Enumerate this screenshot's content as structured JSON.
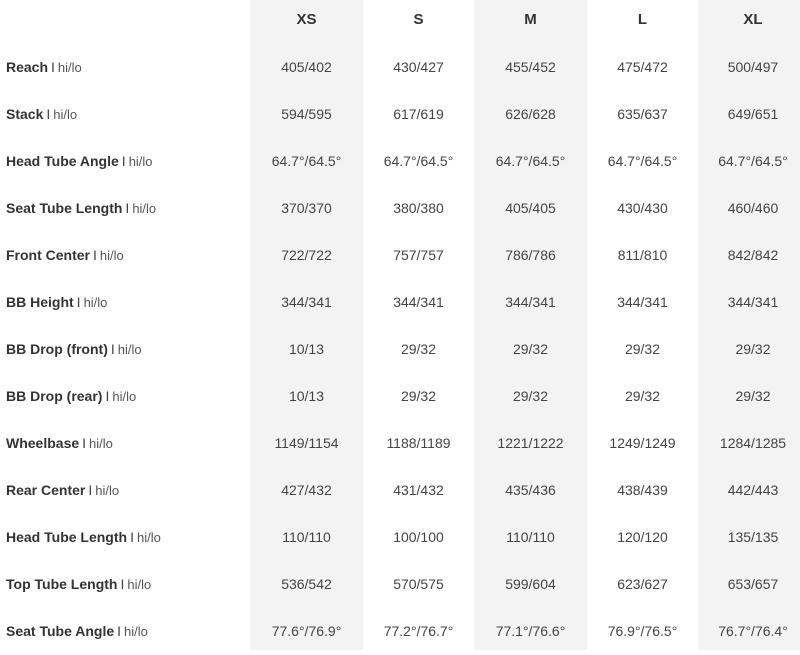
{
  "sizes": [
    "XS",
    "S",
    "M",
    "L",
    "XL"
  ],
  "rows": [
    {
      "label": "Reach",
      "sep": "I",
      "sub": "hi/lo",
      "values": [
        "405/402",
        "430/427",
        "455/452",
        "475/472",
        "500/497"
      ]
    },
    {
      "label": "Stack",
      "sep": "I",
      "sub": "hi/lo",
      "values": [
        "594/595",
        "617/619",
        "626/628",
        "635/637",
        "649/651"
      ]
    },
    {
      "label": "Head Tube Angle",
      "sep": "I",
      "sub": "hi/lo",
      "values": [
        "64.7°/64.5°",
        "64.7°/64.5°",
        "64.7°/64.5°",
        "64.7°/64.5°",
        "64.7°/64.5°"
      ]
    },
    {
      "label": "Seat Tube Length",
      "sep": "I",
      "sub": "hi/lo",
      "values": [
        "370/370",
        "380/380",
        "405/405",
        "430/430",
        "460/460"
      ]
    },
    {
      "label": "Front Center",
      "sep": "I",
      "sub": "hi/lo",
      "values": [
        "722/722",
        "757/757",
        "786/786",
        "811/810",
        "842/842"
      ]
    },
    {
      "label": "BB Height",
      "sep": "I",
      "sub": "hi/lo",
      "values": [
        "344/341",
        "344/341",
        "344/341",
        "344/341",
        "344/341"
      ]
    },
    {
      "label": "BB Drop (front)",
      "sep": "I",
      "sub": "hi/lo",
      "values": [
        "10/13",
        "29/32",
        "29/32",
        "29/32",
        "29/32"
      ]
    },
    {
      "label": "BB Drop (rear)",
      "sep": "I",
      "sub": "hi/lo",
      "values": [
        "10/13",
        "29/32",
        "29/32",
        "29/32",
        "29/32"
      ]
    },
    {
      "label": "Wheelbase",
      "sep": "I",
      "sub": "hi/lo",
      "values": [
        "1149/1154",
        "1188/1189",
        "1221/1222",
        "1249/1249",
        "1284/1285"
      ]
    },
    {
      "label": "Rear Center",
      "sep": "I",
      "sub": "hi/lo",
      "values": [
        "427/432",
        "431/432",
        "435/436",
        "438/439",
        "442/443"
      ]
    },
    {
      "label": "Head Tube Length",
      "sep": "I",
      "sub": "hi/lo",
      "values": [
        "110/110",
        "100/100",
        "110/110",
        "120/120",
        "135/135"
      ]
    },
    {
      "label": "Top Tube Length",
      "sep": "I",
      "sub": "hi/lo",
      "values": [
        "536/542",
        "570/575",
        "599/604",
        "623/627",
        "653/657"
      ]
    },
    {
      "label": "Seat Tube Angle",
      "sep": "I",
      "sub": "hi/lo",
      "values": [
        "77.6°/76.9°",
        "77.2°/76.7°",
        "77.1°/76.6°",
        "76.9°/76.5°",
        "76.7°/76.4°"
      ]
    }
  ]
}
